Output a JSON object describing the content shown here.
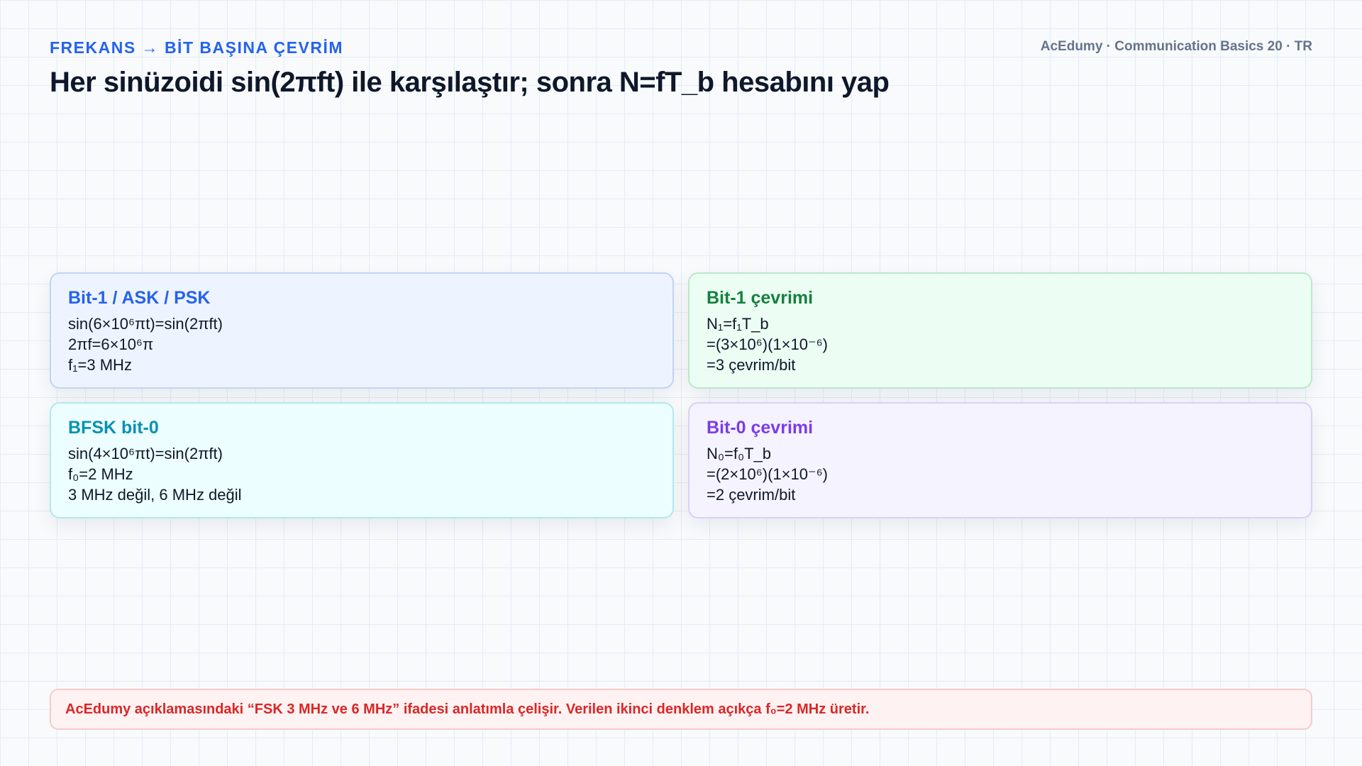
{
  "header": {
    "kicker": "FREKANS → BİT BAŞINA ÇEVRİM",
    "brand": "AcEdumy · Communication Basics 20 · TR",
    "title": "Her sinüzoidi sin(2πft) ile karşılaştır; sonra N=fT_b hesabını yap"
  },
  "cards": [
    {
      "title": "Bit-1 / ASK / PSK",
      "accent": "#2563eb",
      "lines": [
        "sin(6×10⁶πt)=sin(2πft)",
        "2πf=6×10⁶π",
        "f₁=3 MHz"
      ]
    },
    {
      "title": "Bit-1 çevrimi",
      "accent": "#15803d",
      "lines": [
        "N₁=f₁T_b",
        "=(3×10⁶)(1×10⁻⁶)",
        "=3 çevrim/bit"
      ]
    },
    {
      "title": "BFSK bit-0",
      "accent": "#0891b2",
      "lines": [
        "sin(4×10⁶πt)=sin(2πft)",
        "f₀=2 MHz",
        "3 MHz değil, 6 MHz değil"
      ]
    },
    {
      "title": "Bit-0 çevrimi",
      "accent": "#7c3aed",
      "lines": [
        "N₀=f₀T_b",
        "=(2×10⁶)(1×10⁻⁶)",
        "=2 çevrim/bit"
      ]
    }
  ],
  "warning": {
    "text": "AcEdumy açıklamasındaki “FSK 3 MHz ve 6 MHz” ifadesi anlatımla çelişir. Verilen ikinci denklem açıkça f₀=2 MHz üretir.",
    "color": "#dc2626"
  }
}
